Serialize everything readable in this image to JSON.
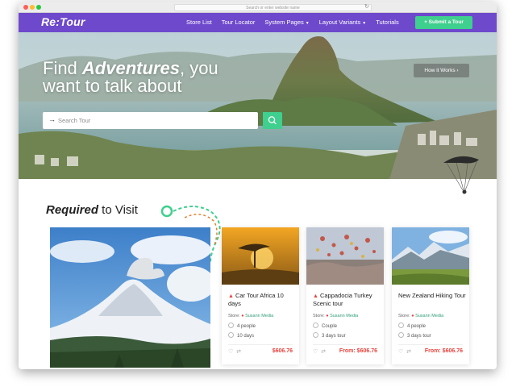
{
  "browser": {
    "url": "Search or enter website name"
  },
  "nav": {
    "logo": "Re:Tour",
    "items": [
      {
        "label": "Store List",
        "dropdown": false
      },
      {
        "label": "Tour Locator",
        "dropdown": false
      },
      {
        "label": "System Pages",
        "dropdown": true
      },
      {
        "label": "Layout Variants",
        "dropdown": true
      },
      {
        "label": "Tutorials",
        "dropdown": false
      }
    ],
    "submit_label": "+ Submit a Tour"
  },
  "hero": {
    "title_line1_prefix": "Find ",
    "title_line1_emphasis": "Adventures",
    "title_line1_suffix": ", you",
    "title_line2": "want to talk about",
    "how_it_works": "How it Works ›",
    "search_placeholder": "Search Tour"
  },
  "section": {
    "title_emphasis": "Required",
    "title_rest": " to Visit"
  },
  "cards": [
    {
      "title": "Car Tour Africa 10 days",
      "store_label": "Store:",
      "store_name": "Susann Media",
      "meta1": "4 people",
      "meta2": "10 days",
      "price": "$606.76"
    },
    {
      "title": "Cappadocia Turkey Scenic tour",
      "store_label": "Store:",
      "store_name": "Susann Media",
      "meta1": "Couple",
      "meta2": "3 days tour",
      "price": "From: $606.76"
    },
    {
      "title": "New Zealand Hiking Tour",
      "store_label": "Store:",
      "store_name": "Susann Media",
      "meta1": "4 people",
      "meta2": "3 days tour",
      "price": "From: $606.76"
    }
  ],
  "colors": {
    "nav_bg": "#6e49cc",
    "accent_green": "#3fcf8e",
    "price_red": "#e9413b",
    "store_green": "#2f9c78"
  },
  "icons": [
    "search-icon",
    "arrow-right-icon",
    "fire-icon",
    "location-pin-icon",
    "heart-icon",
    "compare-icon",
    "users-icon",
    "clock-icon"
  ]
}
